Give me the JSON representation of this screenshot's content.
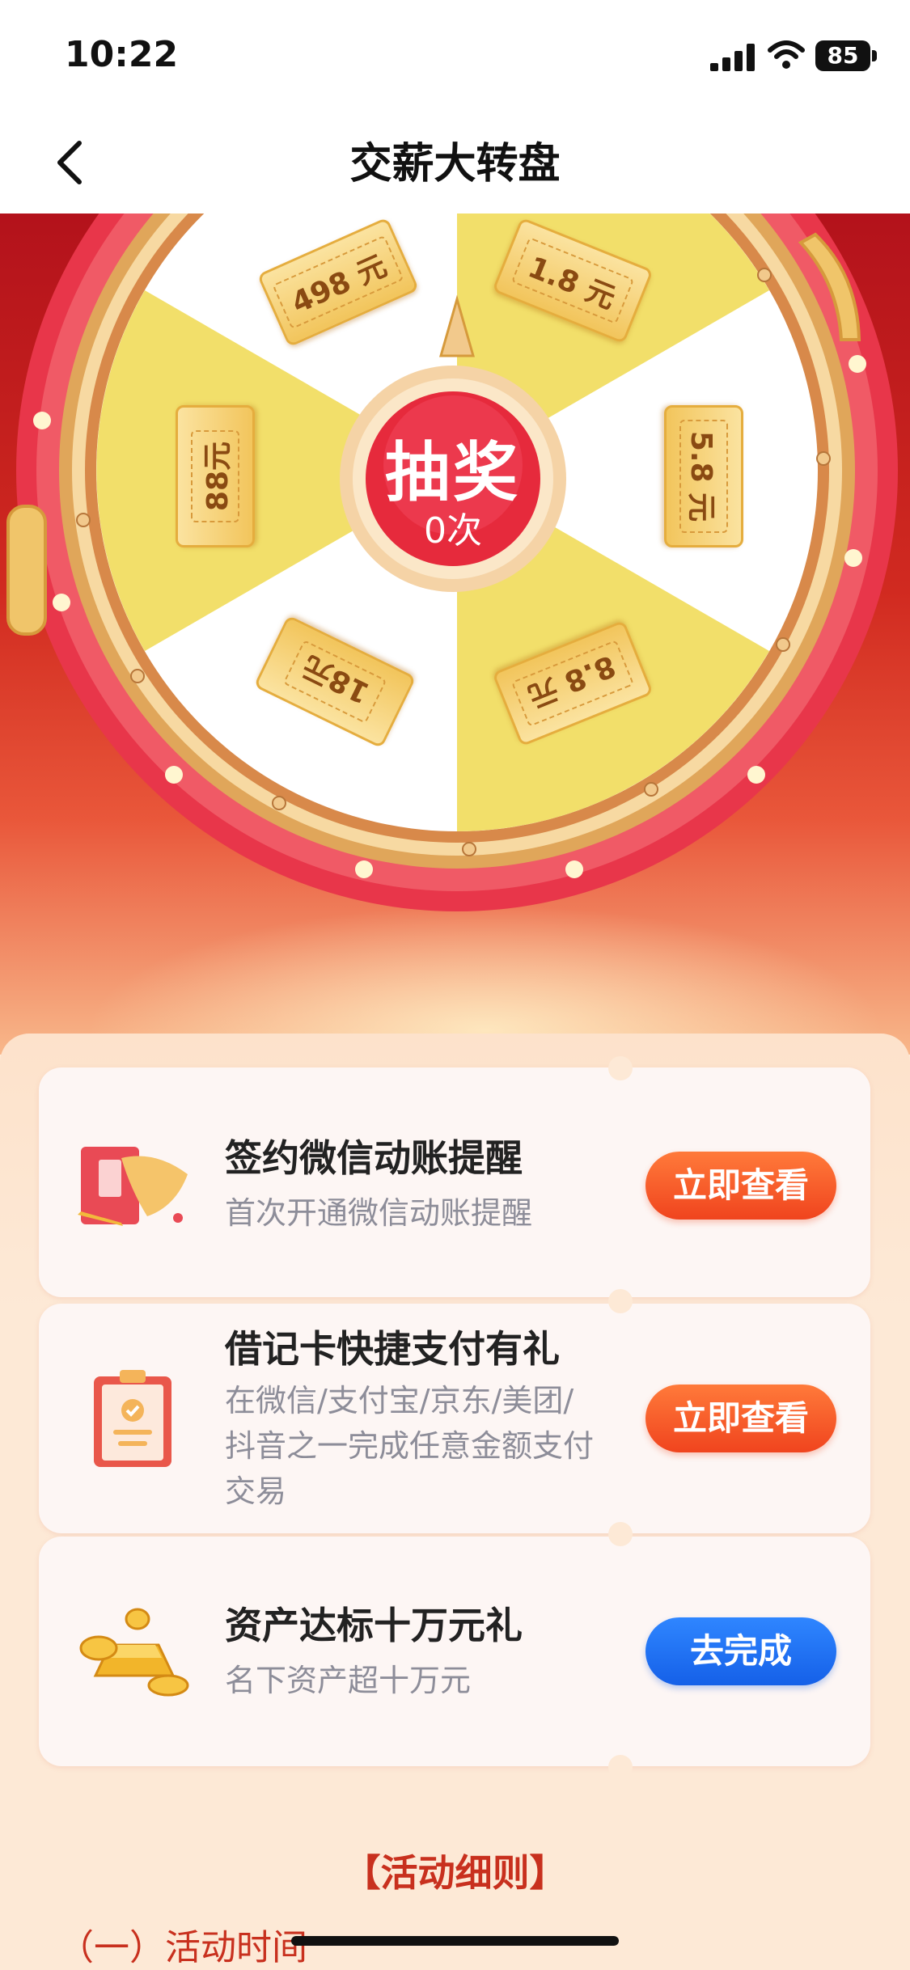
{
  "status_bar": {
    "time": "10:22",
    "battery": "85"
  },
  "nav": {
    "title": "交薪大转盘",
    "back_icon": "chevron-left-icon"
  },
  "wheel": {
    "prizes": [
      "498 元",
      "1.8 元",
      "5.8 元",
      "8.8 元",
      "18元",
      "88元"
    ],
    "draw_label": "抽奖",
    "draw_count": "0次",
    "colors": {
      "segment_yellow": "#f2df6a",
      "segment_white": "#ffffff",
      "rim": "#e8364a",
      "gold": "#e9b864"
    }
  },
  "tasks": [
    {
      "title": "签约微信动账提醒",
      "desc": "首次开通微信动账提醒",
      "button": "立即查看",
      "icon": "card-icon"
    },
    {
      "title": "借记卡快捷支付有礼",
      "desc_lines": [
        "在微信/支付宝/京东/美团/",
        "抖音之一完成任意金额支付",
        "交易"
      ],
      "button": "立即查看",
      "icon": "clipboard-icon"
    },
    {
      "title": "资产达标十万元礼",
      "desc": "名下资产超十万元",
      "button": "去完成",
      "icon": "gold-ingots-icon"
    }
  ],
  "rules": {
    "title": "【活动细则】",
    "first_item": "（一）活动时间"
  },
  "colors": {
    "accent_orange": "#f0441e",
    "accent_blue": "#1560e8",
    "rules_red": "#c8301e"
  }
}
